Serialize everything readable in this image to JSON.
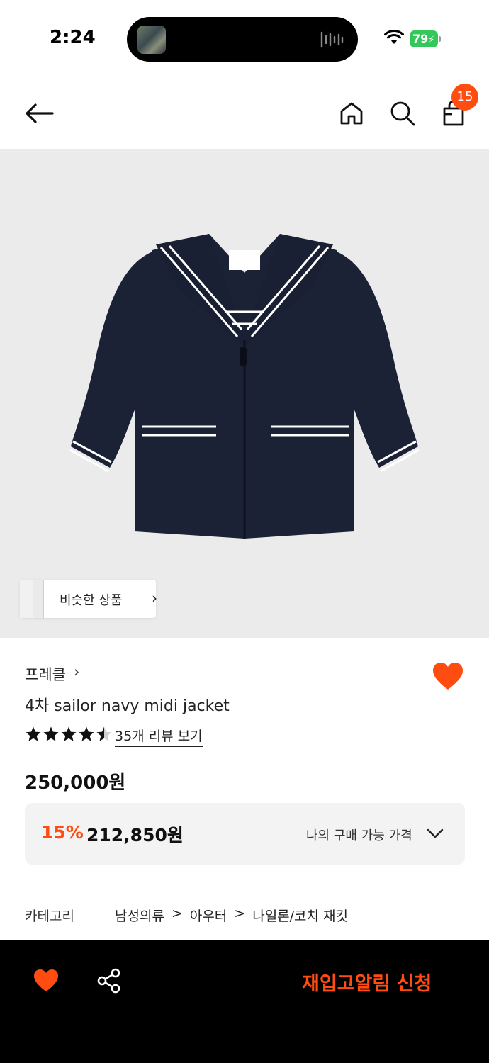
{
  "status_bar": {
    "time": "2:24",
    "battery": "79"
  },
  "nav": {
    "back_icon": "arrow-left-icon",
    "home_icon": "home-icon",
    "search_icon": "search-icon",
    "cart_icon": "shopping-bag-icon",
    "cart_count": "15"
  },
  "hero": {
    "similar_label": "비슷한 상품",
    "similar_chevron": "›"
  },
  "product": {
    "brand": "프레클",
    "brand_chevron": "›",
    "title": "4차 sailor navy midi jacket",
    "rating": 4.5,
    "review_link": "35개 리뷰 보기",
    "price": "250,000원",
    "discount": {
      "rate": "15%",
      "price": "212,850원",
      "my_price_label": "나의 구매 가능 가격"
    },
    "category": {
      "label": "카테고리",
      "path": [
        "남성의류",
        "아우터",
        "나일론/코치 재킷"
      ]
    }
  },
  "bottom_bar": {
    "restock_label": "재입고알림 신청"
  },
  "colors": {
    "accent": "#ff4d12",
    "battery": "#34c759",
    "hero_bg": "#ebebeb",
    "jacket_navy": "#1c2236"
  }
}
